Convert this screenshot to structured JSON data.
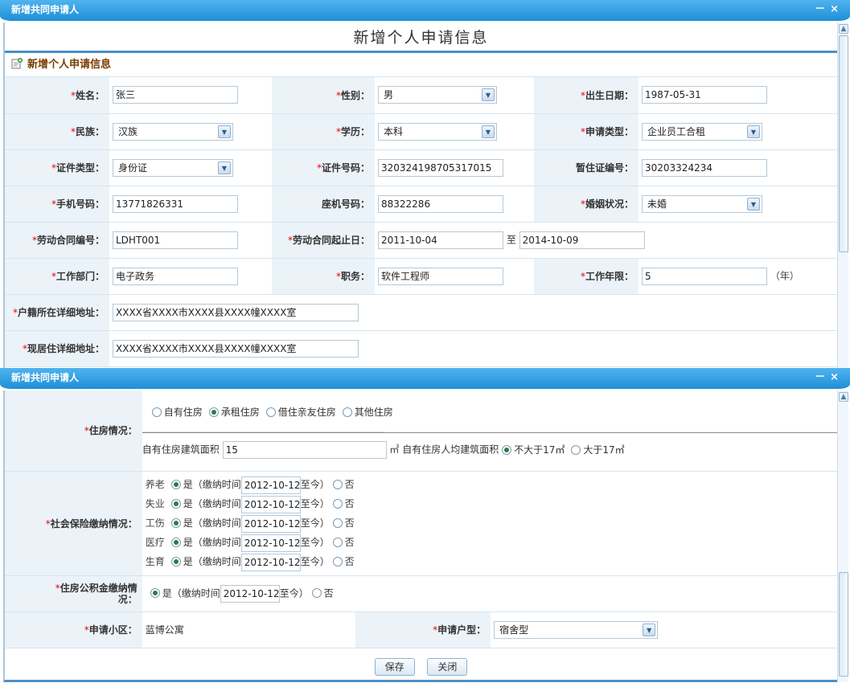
{
  "window1": {
    "title": "新增共同申请人",
    "minimize": "－",
    "close": "×"
  },
  "window2": {
    "title": "新增共同申请人",
    "minimize": "－",
    "close": "×"
  },
  "page_title": "新增个人申请信息",
  "section_title": "新增个人申请信息",
  "req": "*",
  "personal": {
    "name": {
      "label": "姓名：",
      "value": "张三"
    },
    "gender": {
      "label": "性别：",
      "value": "男"
    },
    "birth": {
      "label": "出生日期：",
      "value": "1987-05-31"
    },
    "ethnicity": {
      "label": "民族：",
      "value": "汉族"
    },
    "education": {
      "label": "学历：",
      "value": "本科"
    },
    "apply_type": {
      "label": "申请类型：",
      "value": "企业员工合租"
    },
    "id_type": {
      "label": "证件类型：",
      "value": "身份证"
    },
    "id_no": {
      "label": "证件号码：",
      "value": "320324198705317015"
    },
    "temp_permit": {
      "label": "暂住证编号：",
      "value": "30203324234"
    },
    "mobile": {
      "label": "手机号码：",
      "value": "13771826331"
    },
    "landline": {
      "label": "座机号码：",
      "value": "88322286"
    },
    "marital": {
      "label": "婚姻状况：",
      "value": "未婚"
    },
    "contract_no": {
      "label": "劳动合同编号：",
      "value": "LDHT001"
    },
    "contract_period": {
      "label": "劳动合同起止日：",
      "start": "2011-10-04",
      "sep": "至",
      "end": "2014-10-09"
    },
    "department": {
      "label": "工作部门：",
      "value": "电子政务"
    },
    "position": {
      "label": "职务：",
      "value": "软件工程师"
    },
    "work_years": {
      "label": "工作年限：",
      "value": "5",
      "unit": "（年）"
    },
    "hukou_addr": {
      "label": "户籍所在详细地址：",
      "value": "XXXX省XXXX市XXXX县XXXX幢XXXX室"
    },
    "current_addr": {
      "label": "现居住详细地址：",
      "value": "XXXX省XXXX市XXXX县XXXX幢XXXX室"
    }
  },
  "housing": {
    "label": "住房情况：",
    "options": [
      "自有住房",
      "承租住房",
      "借住亲友住房",
      "其他住房"
    ],
    "selected_index": 1,
    "area_label": "自有住房建筑面积",
    "area_value": "15",
    "area_unit": "㎡",
    "avg_label": "自有住房人均建筑面积",
    "avg_options": [
      "不大于17㎡",
      "大于17㎡"
    ],
    "avg_selected_index": 0
  },
  "insurance": {
    "label": "社会保险缴纳情况：",
    "yes": "是（缴纳时间",
    "until": "至今）",
    "no": "否",
    "items": [
      {
        "name": "养老",
        "date": "2012-10-12"
      },
      {
        "name": "失业",
        "date": "2012-10-12"
      },
      {
        "name": "工伤",
        "date": "2012-10-12"
      },
      {
        "name": "医疗",
        "date": "2012-10-12"
      },
      {
        "name": "生育",
        "date": "2012-10-12"
      }
    ]
  },
  "fund": {
    "label_line1": "住房公积金缴纳情",
    "label_line2": "况：",
    "yes": "是（缴纳时间",
    "date": "2012-10-12",
    "until": "至今）",
    "no": "否"
  },
  "community": {
    "label": "申请小区：",
    "value": "蓝博公寓"
  },
  "unit_type": {
    "label": "申请户型：",
    "value": "宿舍型"
  },
  "buttons": {
    "save": "保存",
    "close": "关闭"
  }
}
